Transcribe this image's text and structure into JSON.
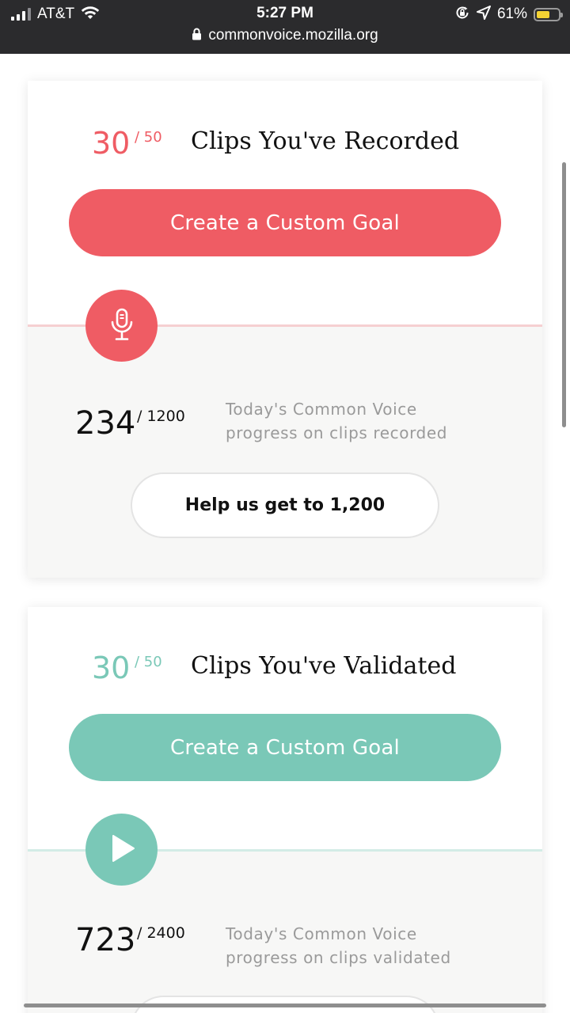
{
  "status_bar": {
    "carrier": "AT&T",
    "time": "5:27 PM",
    "battery_percent": "61%",
    "battery_level": 0.61,
    "url": "commonvoice.mozilla.org",
    "icons": [
      "signal-icon",
      "wifi-icon",
      "orientation-lock-icon",
      "location-icon",
      "battery-icon",
      "lock-icon"
    ]
  },
  "colors": {
    "record_accent": "#ef5c64",
    "validate_accent": "#7ac8b7"
  },
  "record_card": {
    "goal_current": "30",
    "goal_total": "/ 50",
    "title": "Clips You've Recorded",
    "button_label": "Create a Custom Goal",
    "icon": "microphone-icon",
    "today_count": "234",
    "today_total": "/ 1200",
    "today_description": "Today's Common Voice progress on clips recorded",
    "help_button_label": "Help us get to 1,200"
  },
  "validate_card": {
    "goal_current": "30",
    "goal_total": "/ 50",
    "title": "Clips You've Validated",
    "button_label": "Create a Custom Goal",
    "icon": "play-icon",
    "today_count": "723",
    "today_total": "/ 2400",
    "today_description": "Today's Common Voice progress on clips validated"
  }
}
